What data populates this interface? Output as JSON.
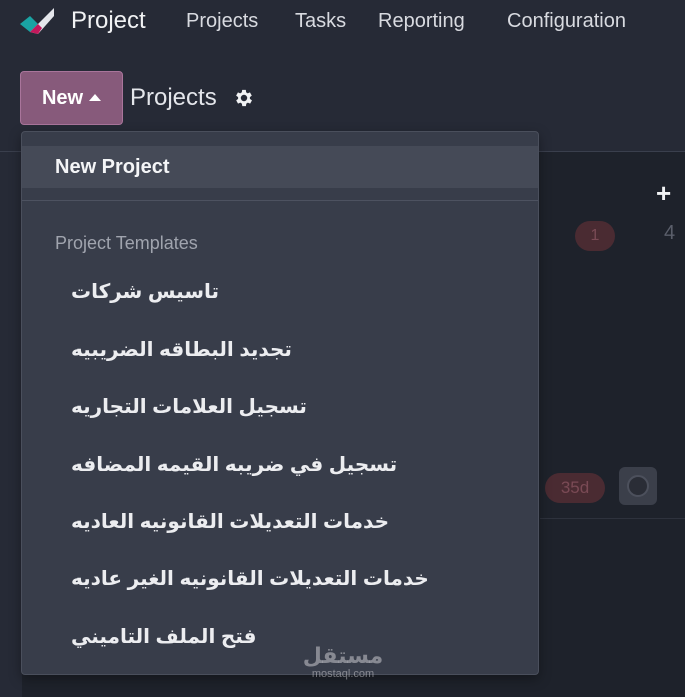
{
  "navbar": {
    "app_title": "Project",
    "items": [
      "Projects",
      "Tasks",
      "Reporting",
      "Configuration"
    ]
  },
  "control_panel": {
    "new_button_label": "New",
    "breadcrumb": "Projects"
  },
  "dropdown": {
    "new_project_label": "New Project",
    "templates_header": "Project Templates",
    "templates": [
      "تاسيس شركات",
      "تجديد البطاقه الضريبيه",
      "تسجيل العلامات التجاريه",
      "تسجيل في ضريبه القيمه المضافه",
      "خدمات التعديلات القانونيه العاديه",
      "خدمات التعديلات القانونيه الغير عاديه",
      "فتح الملف التاميني"
    ]
  },
  "background": {
    "plus_label": "+",
    "badge_count": "1",
    "badge_days": "35d",
    "edge_text": "4"
  },
  "watermark": {
    "arabic": "مستقل",
    "latin": "mostaql.com"
  },
  "colors": {
    "brand": "#875a7b",
    "background": "#262a36",
    "dropdown": "#383d4a"
  },
  "icons": {
    "logo": "project-logo-icon",
    "caret": "caret-up-icon",
    "settings": "gear-icon"
  }
}
